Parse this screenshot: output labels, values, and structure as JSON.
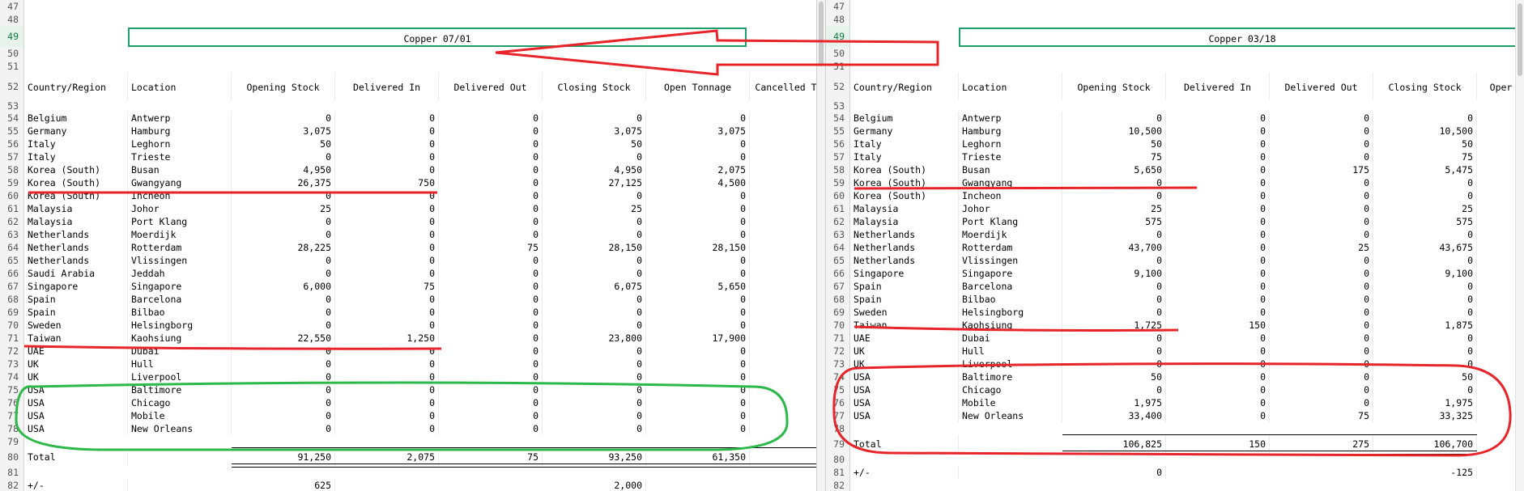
{
  "left": {
    "title": "Copper 07/01",
    "headers": [
      "Country/Region",
      "Location",
      "Opening Stock",
      "Delivered In",
      "Delivered Out",
      "Closing Stock",
      "Open Tonnage",
      "Cancelled T"
    ],
    "top_rows": [
      "47",
      "48",
      "49",
      "50",
      "51"
    ],
    "header_row": "52",
    "blank_row": "53",
    "rows": [
      {
        "n": "54",
        "c": [
          "Belgium",
          "Antwerp",
          "0",
          "0",
          "0",
          "0",
          "0"
        ]
      },
      {
        "n": "55",
        "c": [
          "Germany",
          "Hamburg",
          "3,075",
          "0",
          "0",
          "3,075",
          "3,075"
        ]
      },
      {
        "n": "56",
        "c": [
          "Italy",
          "Leghorn",
          "50",
          "0",
          "0",
          "50",
          "0"
        ]
      },
      {
        "n": "57",
        "c": [
          "Italy",
          "Trieste",
          "0",
          "0",
          "0",
          "0",
          "0"
        ]
      },
      {
        "n": "58",
        "c": [
          "Korea (South)",
          "Busan",
          "4,950",
          "0",
          "0",
          "4,950",
          "2,075"
        ]
      },
      {
        "n": "59",
        "c": [
          "Korea (South)",
          "Gwangyang",
          "26,375",
          "750",
          "0",
          "27,125",
          "4,500"
        ]
      },
      {
        "n": "60",
        "c": [
          "Korea (South)",
          "Incheon",
          "0",
          "0",
          "0",
          "0",
          "0"
        ]
      },
      {
        "n": "61",
        "c": [
          "Malaysia",
          "Johor",
          "25",
          "0",
          "0",
          "25",
          "0"
        ]
      },
      {
        "n": "62",
        "c": [
          "Malaysia",
          "Port Klang",
          "0",
          "0",
          "0",
          "0",
          "0"
        ]
      },
      {
        "n": "63",
        "c": [
          "Netherlands",
          "Moerdijk",
          "0",
          "0",
          "0",
          "0",
          "0"
        ]
      },
      {
        "n": "64",
        "c": [
          "Netherlands",
          "Rotterdam",
          "28,225",
          "0",
          "75",
          "28,150",
          "28,150"
        ]
      },
      {
        "n": "65",
        "c": [
          "Netherlands",
          "Vlissingen",
          "0",
          "0",
          "0",
          "0",
          "0"
        ]
      },
      {
        "n": "66",
        "c": [
          "Saudi Arabia",
          "Jeddah",
          "0",
          "0",
          "0",
          "0",
          "0"
        ]
      },
      {
        "n": "67",
        "c": [
          "Singapore",
          "Singapore",
          "6,000",
          "75",
          "0",
          "6,075",
          "5,650"
        ]
      },
      {
        "n": "68",
        "c": [
          "Spain",
          "Barcelona",
          "0",
          "0",
          "0",
          "0",
          "0"
        ]
      },
      {
        "n": "69",
        "c": [
          "Spain",
          "Bilbao",
          "0",
          "0",
          "0",
          "0",
          "0"
        ]
      },
      {
        "n": "70",
        "c": [
          "Sweden",
          "Helsingborg",
          "0",
          "0",
          "0",
          "0",
          "0"
        ]
      },
      {
        "n": "71",
        "c": [
          "Taiwan",
          "Kaohsiung",
          "22,550",
          "1,250",
          "0",
          "23,800",
          "17,900"
        ]
      },
      {
        "n": "72",
        "c": [
          "UAE",
          "Dubai",
          "0",
          "0",
          "0",
          "0",
          "0"
        ]
      },
      {
        "n": "73",
        "c": [
          "UK",
          "Hull",
          "0",
          "0",
          "0",
          "0",
          "0"
        ]
      },
      {
        "n": "74",
        "c": [
          "UK",
          "Liverpool",
          "0",
          "0",
          "0",
          "0",
          "0"
        ]
      },
      {
        "n": "75",
        "c": [
          "USA",
          "Baltimore",
          "0",
          "0",
          "0",
          "0",
          "0"
        ]
      },
      {
        "n": "76",
        "c": [
          "USA",
          "Chicago",
          "0",
          "0",
          "0",
          "0",
          "0"
        ]
      },
      {
        "n": "77",
        "c": [
          "USA",
          "Mobile",
          "0",
          "0",
          "0",
          "0",
          "0"
        ]
      },
      {
        "n": "78",
        "c": [
          "USA",
          "New Orleans",
          "0",
          "0",
          "0",
          "0",
          "0"
        ]
      }
    ],
    "blank_after": "79",
    "total": {
      "n": "80",
      "label": "Total",
      "vals": [
        "91,250",
        "2,075",
        "75",
        "93,250",
        "61,350"
      ]
    },
    "blank2": "81",
    "diff": {
      "n": "82",
      "label": "+/-",
      "opening": "625",
      "closing": "2,000"
    }
  },
  "right": {
    "title": "Copper  03/18",
    "headers": [
      "Country/Region",
      "Location",
      "Opening Stock",
      "Delivered In",
      "Delivered Out",
      "Closing Stock",
      "Oper"
    ],
    "top_rows": [
      "47",
      "48",
      "49",
      "50",
      "51"
    ],
    "header_row": "52",
    "blank_row": "53",
    "rows": [
      {
        "n": "54",
        "c": [
          "Belgium",
          "Antwerp",
          "0",
          "0",
          "0",
          "0"
        ]
      },
      {
        "n": "55",
        "c": [
          "Germany",
          "Hamburg",
          "10,500",
          "0",
          "0",
          "10,500"
        ]
      },
      {
        "n": "56",
        "c": [
          "Italy",
          "Leghorn",
          "50",
          "0",
          "0",
          "50"
        ]
      },
      {
        "n": "57",
        "c": [
          "Italy",
          "Trieste",
          "75",
          "0",
          "0",
          "75"
        ]
      },
      {
        "n": "58",
        "c": [
          "Korea (South)",
          "Busan",
          "5,650",
          "0",
          "175",
          "5,475"
        ]
      },
      {
        "n": "59",
        "c": [
          "Korea (South)",
          "Gwangyang",
          "0",
          "0",
          "0",
          "0"
        ]
      },
      {
        "n": "60",
        "c": [
          "Korea (South)",
          "Incheon",
          "0",
          "0",
          "0",
          "0"
        ]
      },
      {
        "n": "61",
        "c": [
          "Malaysia",
          "Johor",
          "25",
          "0",
          "0",
          "25"
        ]
      },
      {
        "n": "62",
        "c": [
          "Malaysia",
          "Port Klang",
          "575",
          "0",
          "0",
          "575"
        ]
      },
      {
        "n": "63",
        "c": [
          "Netherlands",
          "Moerdijk",
          "0",
          "0",
          "0",
          "0"
        ]
      },
      {
        "n": "64",
        "c": [
          "Netherlands",
          "Rotterdam",
          "43,700",
          "0",
          "25",
          "43,675"
        ]
      },
      {
        "n": "65",
        "c": [
          "Netherlands",
          "Vlissingen",
          "0",
          "0",
          "0",
          "0"
        ]
      },
      {
        "n": "66",
        "c": [
          "Singapore",
          "Singapore",
          "9,100",
          "0",
          "0",
          "9,100"
        ]
      },
      {
        "n": "67",
        "c": [
          "Spain",
          "Barcelona",
          "0",
          "0",
          "0",
          "0"
        ]
      },
      {
        "n": "68",
        "c": [
          "Spain",
          "Bilbao",
          "0",
          "0",
          "0",
          "0"
        ]
      },
      {
        "n": "69",
        "c": [
          "Sweden",
          "Helsingborg",
          "0",
          "0",
          "0",
          "0"
        ]
      },
      {
        "n": "70",
        "c": [
          "Taiwan",
          "Kaohsiung",
          "1,725",
          "150",
          "0",
          "1,875"
        ]
      },
      {
        "n": "71",
        "c": [
          "UAE",
          "Dubai",
          "0",
          "0",
          "0",
          "0"
        ]
      },
      {
        "n": "72",
        "c": [
          "UK",
          "Hull",
          "0",
          "0",
          "0",
          "0"
        ]
      },
      {
        "n": "73",
        "c": [
          "UK",
          "Liverpool",
          "0",
          "0",
          "0",
          "0"
        ]
      },
      {
        "n": "74",
        "c": [
          "USA",
          "Baltimore",
          "50",
          "0",
          "0",
          "50"
        ]
      },
      {
        "n": "75",
        "c": [
          "USA",
          "Chicago",
          "0",
          "0",
          "0",
          "0"
        ]
      },
      {
        "n": "76",
        "c": [
          "USA",
          "Mobile",
          "1,975",
          "0",
          "0",
          "1,975"
        ]
      },
      {
        "n": "77",
        "c": [
          "USA",
          "New Orleans",
          "33,400",
          "0",
          "75",
          "33,325"
        ]
      }
    ],
    "blank_after": "78",
    "total": {
      "n": "79",
      "label": "Total",
      "vals": [
        "106,825",
        "150",
        "275",
        "106,700"
      ]
    },
    "blank2": "80",
    "diff": {
      "n": "81",
      "label": "+/-",
      "opening": "0",
      "closing": "-125"
    },
    "blank3": "82"
  },
  "colors": {
    "annotation_red": "#e8242b",
    "annotation_green": "#2db84a",
    "title_border": "#1f9e6b"
  }
}
